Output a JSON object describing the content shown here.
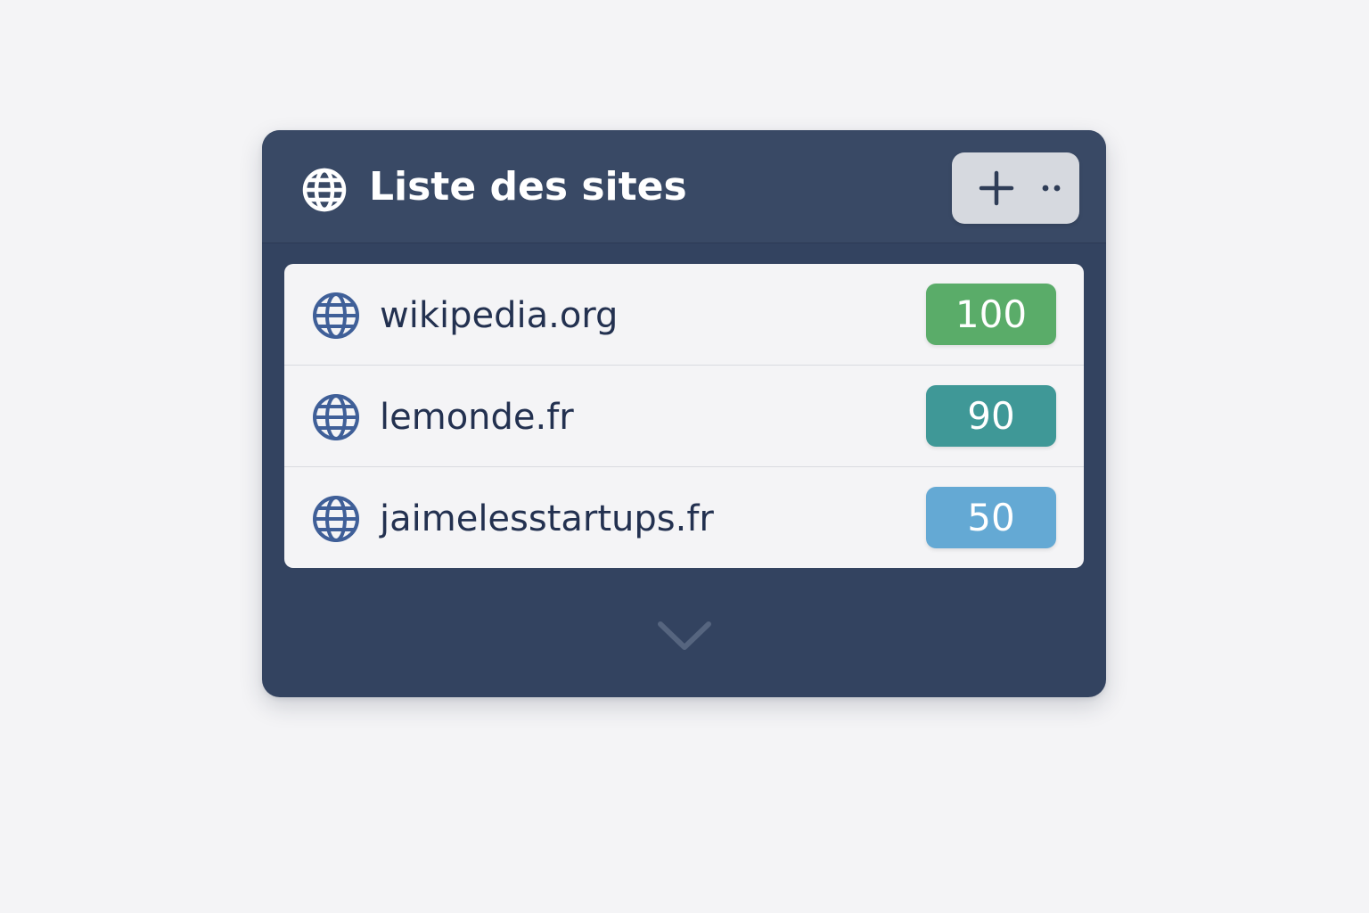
{
  "panel": {
    "title": "Liste des sites",
    "header_icon": "globe-icon",
    "add_icon": "plus-icon",
    "more_icon": "more-dots-icon",
    "expand_icon": "chevron-down-icon"
  },
  "sites": [
    {
      "name": "wikipedia.org",
      "score": "100",
      "icon": "globe-icon",
      "badge_color": "#5aac69"
    },
    {
      "name": "lemonde.fr",
      "score": "90",
      "icon": "globe-icon",
      "badge_color": "#3f9897"
    },
    {
      "name": "jaimelesstartups.fr",
      "score": "50",
      "icon": "globe-icon",
      "badge_color": "#64a9d4"
    }
  ],
  "colors": {
    "panel_bg": "#334360",
    "header_bg": "#394965",
    "list_bg": "#f4f4f6",
    "text_dark": "#233150",
    "icon_blue": "#3f5f98"
  }
}
